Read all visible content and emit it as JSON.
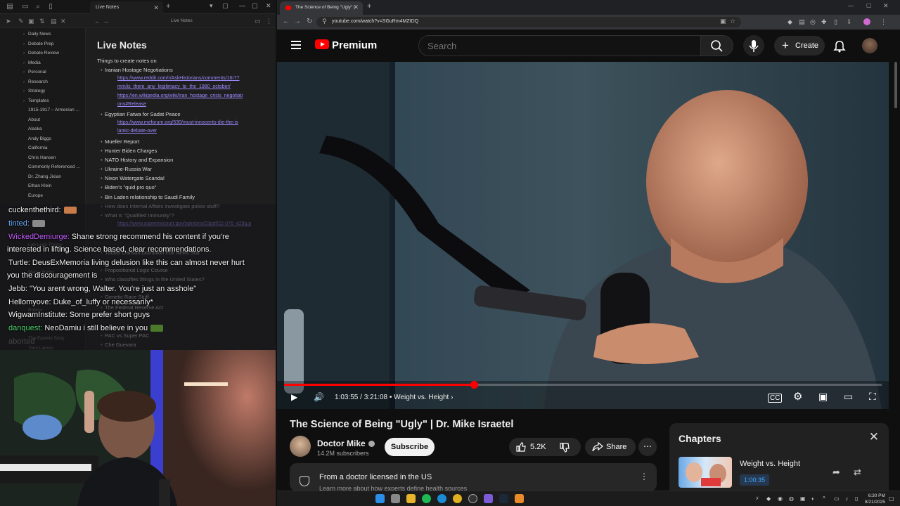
{
  "notes_app": {
    "tab_title": "Live Notes",
    "breadcrumb": "Live Notes",
    "doc_title": "Live Notes",
    "sidebar": [
      {
        "label": "Daily News",
        "folder": true
      },
      {
        "label": "Debate Prep",
        "folder": true
      },
      {
        "label": "Debate Review",
        "folder": true
      },
      {
        "label": "Media",
        "folder": true
      },
      {
        "label": "Personal",
        "folder": true
      },
      {
        "label": "Research",
        "folder": true
      },
      {
        "label": "Strategy",
        "folder": true
      },
      {
        "label": "Templates",
        "folder": true
      },
      {
        "label": "1915-1917 – Armenian ...",
        "folder": false
      },
      {
        "label": "About",
        "folder": false
      },
      {
        "label": "Alaska",
        "folder": false
      },
      {
        "label": "Andy Biggs",
        "folder": false
      },
      {
        "label": "California",
        "folder": false
      },
      {
        "label": "Chris Hansen",
        "folder": false
      },
      {
        "label": "Commonly Referenced ...",
        "folder": false
      },
      {
        "label": "Dr. Zhang Jixian",
        "folder": false
      },
      {
        "label": "Ethan Klein",
        "folder": false
      },
      {
        "label": "Europe",
        "folder": false
      }
    ],
    "sidebar_lower": [
      {
        "label": "Lab Leak Theory"
      },
      {
        "label": "Marco Rubio"
      },
      {
        "label": "Roblox"
      },
      {
        "label": "The Epstein Story"
      },
      {
        "label": "Tomi Lahren"
      }
    ],
    "lines": [
      {
        "text": "Things to create notes on",
        "kind": "plain"
      },
      {
        "text": "Iranian Hostage Negotiations",
        "kind": "b1"
      },
      {
        "text": "https://www.reddit.com/r/AskHistorians/comments/16r77",
        "kind": "link"
      },
      {
        "text": "mm/is_there_any_legitimacy_to_the_1980_october/",
        "kind": "link-cont"
      },
      {
        "text": "https://en.wikipedia.org/wiki/Iran_hostage_crisis_negotiati",
        "kind": "link"
      },
      {
        "text": "ons#Release",
        "kind": "link-cont"
      },
      {
        "text": "Egyptian Fatwa for Sadat Peace",
        "kind": "b1"
      },
      {
        "text": "https://www.meforum.org/530/must-innocents-die-the-is",
        "kind": "link"
      },
      {
        "text": "lamic-debate-over",
        "kind": "link-cont"
      },
      {
        "text": "Mueller Report",
        "kind": "b1"
      },
      {
        "text": "Hunter Biden Charges",
        "kind": "b1"
      },
      {
        "text": "NATO History and Expansion",
        "kind": "b1"
      },
      {
        "text": "Ukraine-Russia War",
        "kind": "b1"
      },
      {
        "text": "Nixon Watergate Scandal",
        "kind": "b1"
      },
      {
        "text": "Biden's \"quid pro quo\"",
        "kind": "b1"
      },
      {
        "text": "Bin Laden relationship to Saudi Family",
        "kind": "b1"
      },
      {
        "text": "How does Internal Affairs investigate police stuff?",
        "kind": "b1"
      },
      {
        "text": "What is \"Qualified Immunity\"?",
        "kind": "b1"
      },
      {
        "text": "https://www.supremecourt.gov/opinions/23pdf/22-976_e29g.p",
        "kind": "link"
      },
      {
        "text": "Tucker Carlson Dominion Fox News Suit",
        "kind": "b1"
      },
      {
        "text": "Propositional Logic Course",
        "kind": "b1"
      },
      {
        "text": "Who classifies things in the United States?",
        "kind": "b1"
      },
      {
        "text": "Genetic Race Stuff",
        "kind": "b1"
      },
      {
        "text": "The Federal Reserve Act",
        "kind": "b1"
      },
      {
        "text": "PAC vs Super PAC",
        "kind": "b1"
      },
      {
        "text": "Che Guevara",
        "kind": "b1"
      }
    ]
  },
  "chat": {
    "messages": [
      {
        "user": "cuckenthethird:",
        "user_color": "#f2f2f2",
        "text": "",
        "emote": "#c97b4a"
      },
      {
        "user": "tinted:",
        "user_color": "#6ab0ff",
        "text": "",
        "emote": "#8a8a8a"
      },
      {
        "user": "WickedDemiurge:",
        "user_color": "#c45cff",
        "text": " Shane strong recommend his content if you're",
        "emote": null
      },
      {
        "user": "",
        "user_color": "#f2f2f2",
        "text": "interested in lifting. Science based, clear recommendations.",
        "emote": null
      },
      {
        "user": "Turtle:",
        "user_color": "#f2f2f2",
        "text": " DeusExMemoria living delusion like this can almost never hurt",
        "emote": null
      },
      {
        "user": "",
        "user_color": "#f2f2f2",
        "text": "you the discouragement is",
        "emote": null
      },
      {
        "user": "Jebb:",
        "user_color": "#f2f2f2",
        "text": " \"You arent wrong, Walter. You're just an asshole\"",
        "emote": null
      },
      {
        "user": "Hellomyove:",
        "user_color": "#f2f2f2",
        "text": " Duke_of_luffy or necessarily*",
        "emote": null
      },
      {
        "user": "WigwamInstitute:",
        "user_color": "#f2f2f2",
        "text": " Some prefer short guys",
        "emote": null
      },
      {
        "user": "danquest:",
        "user_color": "#4fd16f",
        "text": " NeoDamiu i still believe in you",
        "emote": "#4a7a2a"
      }
    ],
    "ghost_text": "aborted"
  },
  "browser": {
    "tab_title": "The Science of Being \"Ugly\" | D...",
    "url": "youtube.com/watch?v=SGuRm4MZtDQ"
  },
  "youtube": {
    "brand": "Premium",
    "search_placeholder": "Search",
    "create_label": "Create",
    "video": {
      "current_time": "1:03:55",
      "duration": "3:21:08",
      "chapter": "Weight vs. Height",
      "progress_fraction": 0.3177
    },
    "title": "The Science of Being \"Ugly\" | Dr. Mike Israetel",
    "channel": "Doctor Mike",
    "subscribers": "14.2M subscribers",
    "subscribe_label": "Subscribe",
    "likes": "5.2K",
    "share_label": "Share",
    "info_box": {
      "title": "From a doctor licensed in the US",
      "subtitle": "Learn more about how experts define health sources"
    },
    "chapters_panel": {
      "heading": "Chapters",
      "items": [
        {
          "title": "Weight vs. Height",
          "timestamp": "1:00:35"
        }
      ]
    }
  },
  "taskbar": {
    "time": "6:30 PM",
    "date": "8/21/2025"
  },
  "colors": {
    "yt_red": "#ff0000",
    "link": "#9d8bff",
    "timestamp_blue": "#3ea6ff"
  }
}
